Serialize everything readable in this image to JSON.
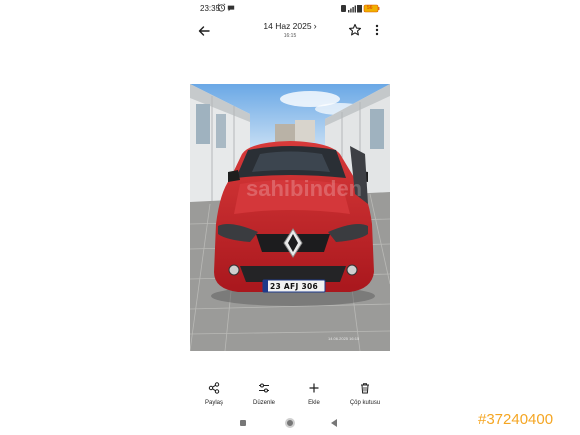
{
  "status_bar": {
    "time": "23:35",
    "battery": "56",
    "icons": [
      "alarm-icon",
      "message-icon",
      "wifi-icon",
      "signal-icon",
      "battery-icon"
    ]
  },
  "header": {
    "date": "14 Haz 2025",
    "subtitle": "16:15",
    "back_icon": "arrow-left-icon",
    "favorite_icon": "star-outline-icon",
    "more_icon": "more-vert-icon"
  },
  "photo": {
    "plate": "23 AFJ 306",
    "watermark": "sahibinden",
    "stamp": "14.06.2025 16:15",
    "colors": {
      "car_body": "#c8232a",
      "sky": "#7fb6ea",
      "pavement": "#9a9a98"
    }
  },
  "actions": [
    {
      "label": "Paylaş",
      "icon": "share-icon"
    },
    {
      "label": "Düzenle",
      "icon": "tune-icon"
    },
    {
      "label": "Ekle",
      "icon": "plus-icon"
    },
    {
      "label": "Çöp kutusu",
      "icon": "trash-icon"
    }
  ],
  "nav": {
    "icons": [
      "recents-icon",
      "home-icon",
      "back-triangle-icon"
    ]
  },
  "listing_id": "#37240400"
}
